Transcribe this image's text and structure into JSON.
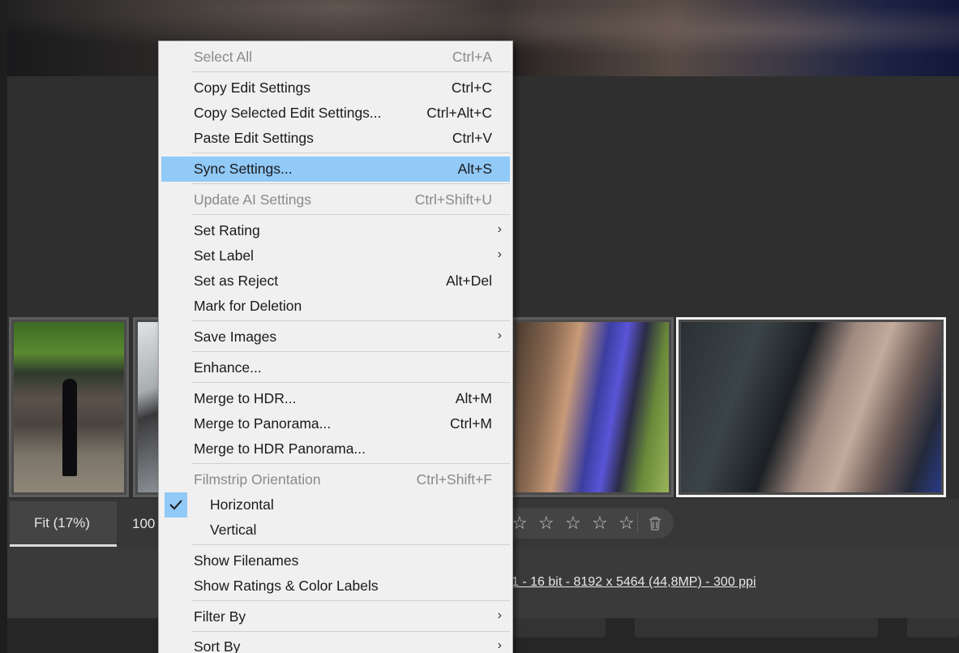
{
  "menu": {
    "items": [
      {
        "label": "Select All",
        "shortcut": "Ctrl+A",
        "state": "disabled"
      },
      {
        "label": "Copy Edit Settings",
        "shortcut": "Ctrl+C"
      },
      {
        "label": "Copy Selected Edit Settings...",
        "shortcut": "Ctrl+Alt+C"
      },
      {
        "label": "Paste Edit Settings",
        "shortcut": "Ctrl+V"
      },
      {
        "label": "Sync Settings...",
        "shortcut": "Alt+S",
        "state": "highlighted"
      },
      {
        "label": "Update AI Settings",
        "shortcut": "Ctrl+Shift+U",
        "state": "disabled"
      },
      {
        "label": "Set Rating",
        "submenu": true
      },
      {
        "label": "Set Label",
        "submenu": true
      },
      {
        "label": "Set as Reject",
        "shortcut": "Alt+Del"
      },
      {
        "label": "Mark for Deletion"
      },
      {
        "label": "Save Images",
        "submenu": true
      },
      {
        "label": "Enhance..."
      },
      {
        "label": "Merge to HDR...",
        "shortcut": "Alt+M"
      },
      {
        "label": "Merge to Panorama...",
        "shortcut": "Ctrl+M"
      },
      {
        "label": "Merge to HDR Panorama..."
      },
      {
        "label": "Filmstrip Orientation",
        "shortcut": "Ctrl+Shift+F",
        "state": "disabled"
      },
      {
        "label": "Horizontal",
        "checked": true
      },
      {
        "label": "Vertical"
      },
      {
        "label": "Show Filenames"
      },
      {
        "label": "Show Ratings & Color Labels"
      },
      {
        "label": "Filter By",
        "submenu": true
      },
      {
        "label": "Sort By",
        "submenu": true
      }
    ],
    "submenu_arrow": "›",
    "check_icon": "checkmark-icon"
  },
  "zoom": {
    "fit_label": "Fit (17%)",
    "hundred_label": "100"
  },
  "rating": {
    "stars": [
      "☆",
      "☆",
      "☆",
      "☆",
      "☆"
    ],
    "delete_icon": "trash-icon"
  },
  "image_info": "1 - 16 bit - 8192 x 5464 (44,8MP) - 300 ppi",
  "colors": {
    "highlight": "#91c9f7",
    "menu_bg": "#f0f0f0",
    "app_bg": "#2b2b2b"
  }
}
